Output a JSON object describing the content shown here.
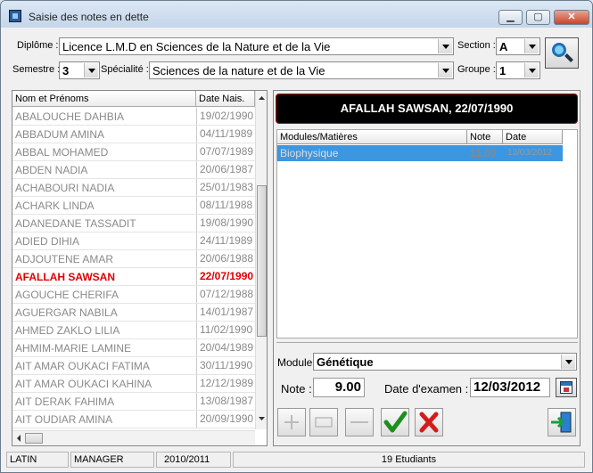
{
  "window": {
    "title": "Saisie des notes en dette"
  },
  "filters": {
    "diplome_label": "Diplôme :",
    "diplome_value": "Licence L.M.D en Sciences de la Nature et de la Vie",
    "semestre_label": "Semestre :",
    "semestre_value": "3",
    "specialite_label": "Spécialité :",
    "specialite_value": "Sciences de la nature et de la Vie",
    "section_label": "Section :",
    "section_value": "A",
    "groupe_label": "Groupe :",
    "groupe_value": "1"
  },
  "students": {
    "col_name": "Nom et Prénoms",
    "col_date": "Date Nais.",
    "rows": [
      {
        "name": "ABALOUCHE  DAHBIA",
        "date": "19/02/1990"
      },
      {
        "name": "ABBADUM  AMINA",
        "date": "04/11/1989"
      },
      {
        "name": "ABBAL  MOHAMED",
        "date": "07/07/1989"
      },
      {
        "name": "ABDEN  NADIA",
        "date": "20/06/1987"
      },
      {
        "name": "ACHABOURI  NADIA",
        "date": "25/01/1983"
      },
      {
        "name": "ACHARK  LINDA",
        "date": "08/11/1988"
      },
      {
        "name": "ADANEDANE  TASSADIT",
        "date": "19/08/1990"
      },
      {
        "name": "ADIED  DIHIA",
        "date": "24/11/1989"
      },
      {
        "name": "ADJOUTENE  AMAR",
        "date": "20/06/1988"
      },
      {
        "name": "AFALLAH  SAWSAN",
        "date": "22/07/1990"
      },
      {
        "name": "AGOUCHE  CHERIFA",
        "date": "07/12/1988"
      },
      {
        "name": "AGUERGAR  NABILA",
        "date": "14/01/1987"
      },
      {
        "name": "AHMED ZAKLO  LILIA",
        "date": "11/02/1990"
      },
      {
        "name": "AHMIM-MARIE  LAMINE",
        "date": "20/04/1989"
      },
      {
        "name": "AIT AMAR OUKACI  FATIMA",
        "date": "30/11/1990"
      },
      {
        "name": "AIT AMAR OUKACI  KAHINA",
        "date": "12/12/1989"
      },
      {
        "name": "AIT DERAK  FAHIMA",
        "date": "13/08/1987"
      },
      {
        "name": "AIT OUDIAR  AMINA",
        "date": "20/09/1990"
      }
    ],
    "selected_index": 9
  },
  "detail": {
    "student_header": "AFALLAH  SAWSAN, 22/07/1990",
    "col_module": "Modules/Matières",
    "col_note": "Note",
    "col_date": "Date",
    "grades": [
      {
        "module": "Biophysique",
        "note": "11.00",
        "date": "13/03/2012"
      }
    ],
    "module_label": "Module :",
    "module_value": "Génétique",
    "note_label": "Note :",
    "note_value": "9.00",
    "date_exam_label": "Date d'examen :",
    "date_exam_value": "12/03/2012"
  },
  "status": {
    "lang": "LATIN",
    "role": "MANAGER",
    "year": "2010/2011",
    "count": "19 Etudiants"
  }
}
